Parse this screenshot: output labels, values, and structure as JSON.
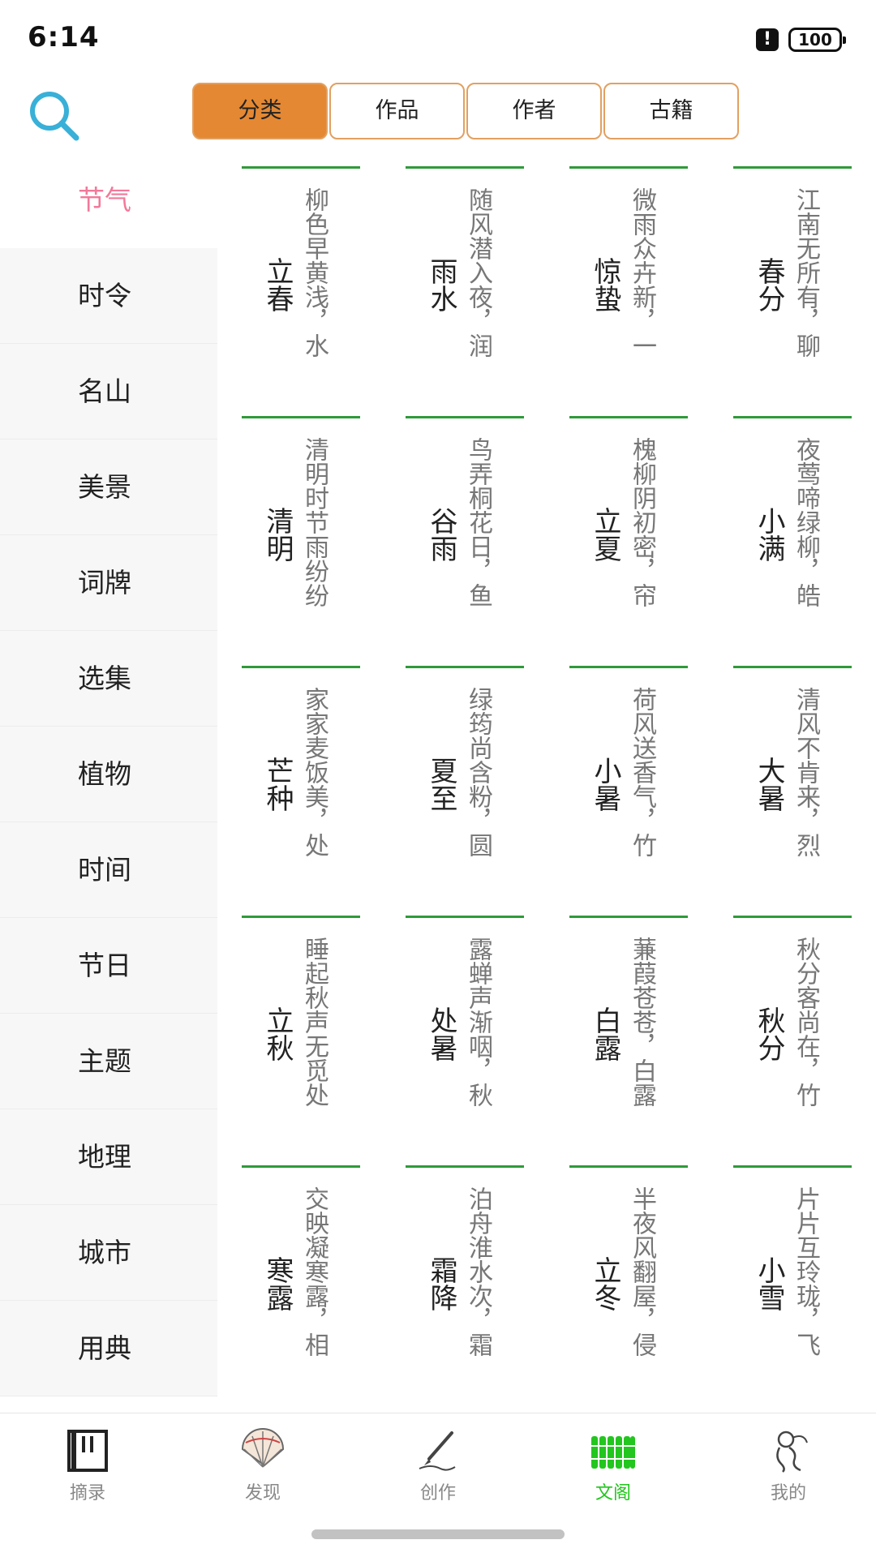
{
  "status_bar": {
    "time": "6:14",
    "alert_glyph": "!",
    "battery": "100"
  },
  "header": {
    "search_icon": "search-icon",
    "tabs": [
      {
        "label": "分类",
        "active": true
      },
      {
        "label": "作品",
        "active": false
      },
      {
        "label": "作者",
        "active": false
      },
      {
        "label": "古籍",
        "active": false
      }
    ],
    "accent_color": "#e48833"
  },
  "sidebar": {
    "items": [
      {
        "label": "节气",
        "active": true
      },
      {
        "label": "时令"
      },
      {
        "label": "名山"
      },
      {
        "label": "美景"
      },
      {
        "label": "词牌"
      },
      {
        "label": "选集"
      },
      {
        "label": "植物"
      },
      {
        "label": "时间"
      },
      {
        "label": "节日"
      },
      {
        "label": "主题"
      },
      {
        "label": "地理"
      },
      {
        "label": "城市"
      },
      {
        "label": "用典"
      }
    ],
    "active_color": "#f2799a"
  },
  "grid": {
    "line_color": "#2f9a3a",
    "cells": [
      {
        "title": "立春",
        "excerpt": "柳色早黄浅，水"
      },
      {
        "title": "雨水",
        "excerpt": "随风潜入夜，润"
      },
      {
        "title": "惊蛰",
        "excerpt": "微雨众卉新，一"
      },
      {
        "title": "春分",
        "excerpt": "江南无所有，聊"
      },
      {
        "title": "清明",
        "excerpt": "清明时节雨纷纷"
      },
      {
        "title": "谷雨",
        "excerpt": "鸟弄桐花日，鱼"
      },
      {
        "title": "立夏",
        "excerpt": "槐柳阴初密，帘"
      },
      {
        "title": "小满",
        "excerpt": "夜莺啼绿柳，皓"
      },
      {
        "title": "芒种",
        "excerpt": "家家麦饭美，处"
      },
      {
        "title": "夏至",
        "excerpt": "绿筠尚含粉，圆"
      },
      {
        "title": "小暑",
        "excerpt": "荷风送香气，竹"
      },
      {
        "title": "大暑",
        "excerpt": "清风不肯来，烈"
      },
      {
        "title": "立秋",
        "excerpt": "睡起秋声无觅处"
      },
      {
        "title": "处暑",
        "excerpt": "露蝉声渐咽，秋"
      },
      {
        "title": "白露",
        "excerpt": "蒹葭苍苍，白露"
      },
      {
        "title": "秋分",
        "excerpt": "秋分客尚在，竹"
      },
      {
        "title": "寒露",
        "excerpt": "交映凝寒露，相"
      },
      {
        "title": "霜降",
        "excerpt": "泊舟淮水次，霜"
      },
      {
        "title": "立冬",
        "excerpt": "半夜风翻屋，侵"
      },
      {
        "title": "小雪",
        "excerpt": "片片互玲珑，飞"
      }
    ]
  },
  "bottom_nav": {
    "active_color": "#22c61e",
    "items": [
      {
        "label": "摘录",
        "icon": "book-icon"
      },
      {
        "label": "发现",
        "icon": "fan-icon"
      },
      {
        "label": "创作",
        "icon": "brush-pen-icon"
      },
      {
        "label": "文阁",
        "icon": "bamboo-scroll-icon",
        "active": true
      },
      {
        "label": "我的",
        "icon": "profile-figure-icon"
      }
    ]
  }
}
